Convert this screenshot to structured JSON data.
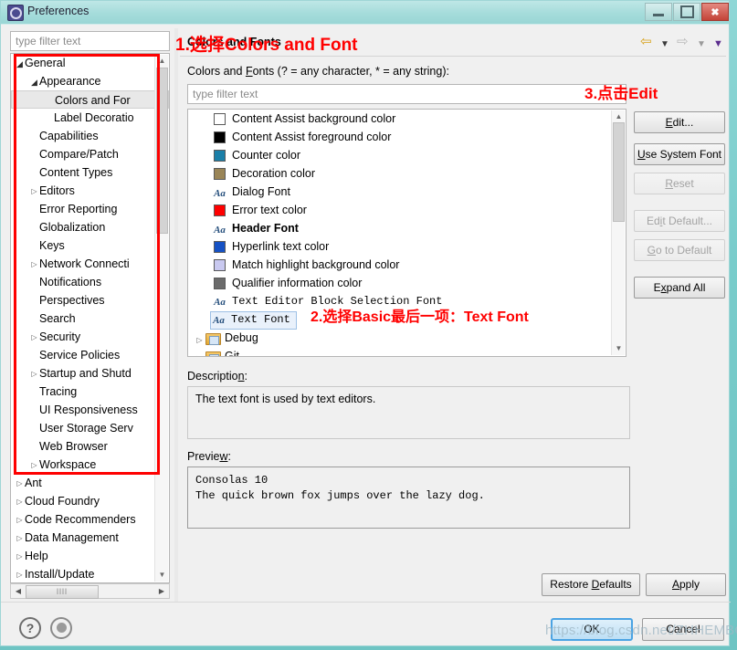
{
  "window": {
    "title": "Preferences",
    "icon": "preferences-gear-icon",
    "minimize_label": "–",
    "maximize_label": "□",
    "close_label": "✕"
  },
  "sidebar": {
    "filter_placeholder": "type filter text",
    "items": [
      {
        "label": "General",
        "depth": 0,
        "arrow": "open"
      },
      {
        "label": "Appearance",
        "depth": 1,
        "arrow": "open"
      },
      {
        "label": "Colors and For",
        "depth": 2,
        "arrow": "none",
        "selected": true
      },
      {
        "label": "Label Decoratio",
        "depth": 2,
        "arrow": "none"
      },
      {
        "label": "Capabilities",
        "depth": 1,
        "arrow": "none"
      },
      {
        "label": "Compare/Patch",
        "depth": 1,
        "arrow": "none"
      },
      {
        "label": "Content Types",
        "depth": 1,
        "arrow": "none"
      },
      {
        "label": "Editors",
        "depth": 1,
        "arrow": "closed"
      },
      {
        "label": "Error Reporting",
        "depth": 1,
        "arrow": "none"
      },
      {
        "label": "Globalization",
        "depth": 1,
        "arrow": "none"
      },
      {
        "label": "Keys",
        "depth": 1,
        "arrow": "none"
      },
      {
        "label": "Network Connecti",
        "depth": 1,
        "arrow": "closed"
      },
      {
        "label": "Notifications",
        "depth": 1,
        "arrow": "none"
      },
      {
        "label": "Perspectives",
        "depth": 1,
        "arrow": "none"
      },
      {
        "label": "Search",
        "depth": 1,
        "arrow": "none"
      },
      {
        "label": "Security",
        "depth": 1,
        "arrow": "closed"
      },
      {
        "label": "Service Policies",
        "depth": 1,
        "arrow": "none"
      },
      {
        "label": "Startup and Shutd",
        "depth": 1,
        "arrow": "closed"
      },
      {
        "label": "Tracing",
        "depth": 1,
        "arrow": "none"
      },
      {
        "label": "UI Responsiveness",
        "depth": 1,
        "arrow": "none"
      },
      {
        "label": "User Storage Serv",
        "depth": 1,
        "arrow": "none"
      },
      {
        "label": "Web Browser",
        "depth": 1,
        "arrow": "none"
      },
      {
        "label": "Workspace",
        "depth": 1,
        "arrow": "closed"
      },
      {
        "label": "Ant",
        "depth": 0,
        "arrow": "closed"
      },
      {
        "label": "Cloud Foundry",
        "depth": 0,
        "arrow": "closed"
      },
      {
        "label": "Code Recommenders",
        "depth": 0,
        "arrow": "closed"
      },
      {
        "label": "Data Management",
        "depth": 0,
        "arrow": "closed"
      },
      {
        "label": "Help",
        "depth": 0,
        "arrow": "closed"
      },
      {
        "label": "Install/Update",
        "depth": 0,
        "arrow": "closed"
      }
    ],
    "hscroll_thumb_glyph": "llll",
    "scroll_left_glyph": "◀",
    "scroll_right_glyph": "▶",
    "scroll_up_glyph": "▲",
    "scroll_down_glyph": "▼"
  },
  "header": {
    "title": "Colors and Fonts",
    "nav_back_icon": "back-arrow-icon",
    "nav_back_menu_icon": "chevron-down-icon",
    "nav_forward_icon": "forward-arrow-icon",
    "nav_forward_menu_icon": "chevron-down-icon",
    "nav_more_icon": "chevron-down-icon"
  },
  "main": {
    "filter_label_pre": "Colors and ",
    "filter_label_accel": "F",
    "filter_label_post": "onts (? = any character, * = any string):",
    "filter_placeholder": "type filter text",
    "list": [
      {
        "label": "Content Assist background color",
        "kind": "color",
        "color": "#ffffff"
      },
      {
        "label": "Content Assist foreground color",
        "kind": "color",
        "color": "#000000"
      },
      {
        "label": "Counter color",
        "kind": "color",
        "color": "#1a7fa8"
      },
      {
        "label": "Decoration color",
        "kind": "color",
        "color": "#9a8557"
      },
      {
        "label": "Dialog Font",
        "kind": "font",
        "style": "normal"
      },
      {
        "label": "Error text color",
        "kind": "color",
        "color": "#ff0000"
      },
      {
        "label": "Header Font",
        "kind": "font",
        "style": "bold"
      },
      {
        "label": "Hyperlink text color",
        "kind": "color",
        "color": "#1551c4"
      },
      {
        "label": "Match highlight background color",
        "kind": "color",
        "color": "#c9c9f0"
      },
      {
        "label": "Qualifier information color",
        "kind": "color",
        "color": "#6b6b6b"
      },
      {
        "label": "Text Editor Block Selection Font",
        "kind": "font",
        "style": "mono"
      },
      {
        "label": "Text Font",
        "kind": "font",
        "style": "mono",
        "selected": true
      },
      {
        "label": "Debug",
        "kind": "folder",
        "arrow": "closed"
      },
      {
        "label": "Git",
        "kind": "folder",
        "arrow": "closed"
      }
    ]
  },
  "buttons": {
    "edit": {
      "pre": "",
      "accel": "E",
      "post": "dit...",
      "enabled": true
    },
    "use_system_font": {
      "pre": "",
      "accel": "U",
      "post": "se System Font",
      "enabled": true
    },
    "reset": {
      "pre": "",
      "accel": "R",
      "post": "eset",
      "enabled": false
    },
    "edit_default": {
      "pre": "Ed",
      "accel": "i",
      "post": "t Default...",
      "enabled": false
    },
    "go_to_default": {
      "pre": "",
      "accel": "G",
      "post": "o to Default",
      "enabled": false
    },
    "expand_all": {
      "pre": "E",
      "accel": "x",
      "post": "pand All",
      "enabled": true
    }
  },
  "description": {
    "label_pre": "Descriptio",
    "label_accel": "n",
    "label_post": ":",
    "text": "The text font is used by text editors."
  },
  "preview": {
    "label_pre": "Previe",
    "label_accel": "w",
    "label_post": ":",
    "line1": "Consolas 10",
    "line2": "The quick brown fox jumps over the lazy dog."
  },
  "footer": {
    "help_icon": "question-mark-icon",
    "apply_icon": "apply-circle-icon",
    "restore_defaults": {
      "pre": "Restore ",
      "accel": "D",
      "post": "efaults"
    },
    "apply": {
      "pre": "",
      "accel": "A",
      "post": "pply"
    },
    "ok": "OK",
    "cancel": "Cancel"
  },
  "annotations": {
    "step1": "1.选择Colors and Font",
    "step2": "2.选择Basic最后一项：Text Font",
    "step3": "3.点击Edit",
    "highlight_color": "#ff0000"
  },
  "watermark": "https://blog.csdn.net/ZHHEMBC"
}
